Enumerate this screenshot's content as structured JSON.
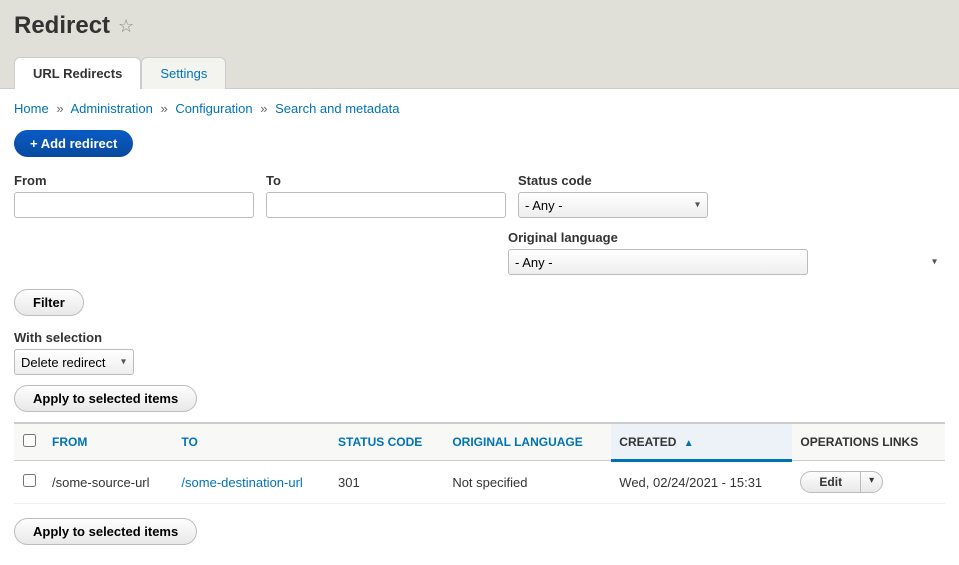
{
  "page": {
    "title": "Redirect"
  },
  "tabs": {
    "url_redirects": "URL Redirects",
    "settings": "Settings"
  },
  "breadcrumb": {
    "home": "Home",
    "administration": "Administration",
    "configuration": "Configuration",
    "search_metadata": "Search and metadata"
  },
  "buttons": {
    "add_redirect": "+ Add redirect",
    "filter": "Filter",
    "apply_selected": "Apply to selected items",
    "edit": "Edit"
  },
  "filters": {
    "from_label": "From",
    "to_label": "To",
    "status_label": "Status code",
    "status_value": "- Any -",
    "language_label": "Original language",
    "language_value": "- Any -"
  },
  "with_selection": {
    "label": "With selection",
    "value": "Delete redirect"
  },
  "table": {
    "headers": {
      "from": "FROM",
      "to": "TO",
      "status": "STATUS CODE",
      "language": "ORIGINAL LANGUAGE",
      "created": "CREATED",
      "operations": "OPERATIONS LINKS"
    },
    "rows": [
      {
        "from": "/some-source-url",
        "to": "/some-destination-url",
        "status": "301",
        "language": "Not specified",
        "created": "Wed, 02/24/2021 - 15:31"
      }
    ]
  }
}
